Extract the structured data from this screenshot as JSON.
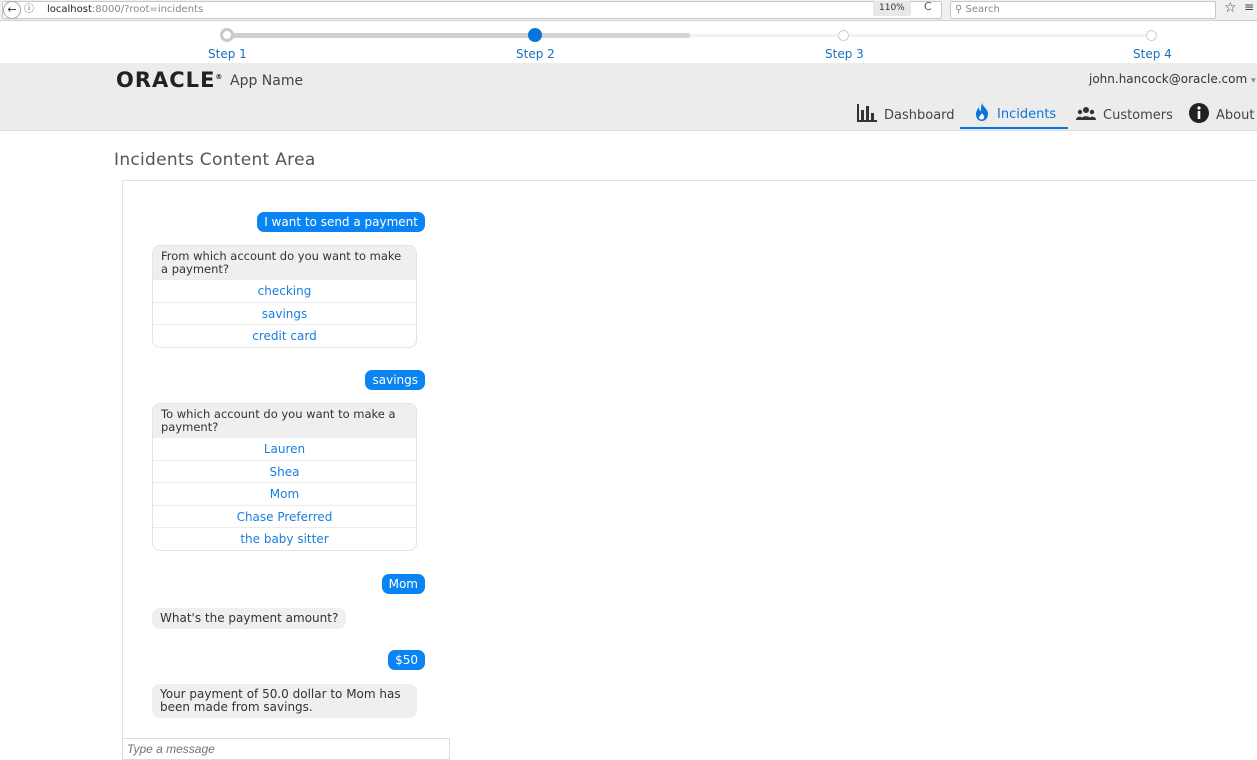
{
  "browser": {
    "back": "←",
    "info": "ⓘ",
    "url_host": "localhost",
    "url_rest": ":8000/?root=incidents",
    "zoom": "110%",
    "reload": "C",
    "search_placeholder": "Search",
    "star": "☆",
    "menu": "≡"
  },
  "stepper": {
    "steps": [
      {
        "label": "Step 1"
      },
      {
        "label": "Step 2"
      },
      {
        "label": "Step 3"
      },
      {
        "label": "Step 4"
      }
    ],
    "current_step": 2
  },
  "header": {
    "logo": "ORACLE",
    "logo_mark": "®",
    "app_name": "App Name",
    "user": "john.hancock@oracle.com",
    "user_caret": "▾",
    "nav": [
      {
        "label": "Dashboard",
        "icon": "bar-chart-icon"
      },
      {
        "label": "Incidents",
        "icon": "flame-icon",
        "active": true
      },
      {
        "label": "Customers",
        "icon": "people-icon"
      },
      {
        "label": "About",
        "icon": "info-icon"
      }
    ]
  },
  "content": {
    "title": "Incidents Content Area",
    "messages": {
      "user_1": "I want to send a payment",
      "bot_1_question": "From which account do you want to make a payment?",
      "bot_1_options": [
        "checking",
        "savings",
        "credit card"
      ],
      "user_2": "savings",
      "bot_2_question": "To which account do you want to make a payment?",
      "bot_2_options": [
        "Lauren",
        "Shea",
        "Mom",
        "Chase Preferred",
        "the baby sitter"
      ],
      "user_3": "Mom",
      "bot_3": "What's the payment amount?",
      "user_4": "$50",
      "bot_4": "Your payment of 50.0 dollar to Mom has been made from savings."
    },
    "input_placeholder": "Type a message"
  },
  "colors": {
    "accent": "#0a74da",
    "user_bubble": "#0a84f2",
    "bot_bubble": "#f0eff0",
    "header_bg": "#ececec"
  }
}
